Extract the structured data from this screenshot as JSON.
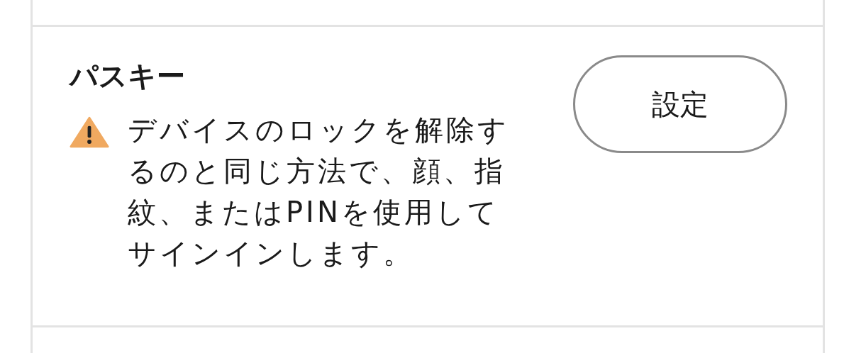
{
  "passkey": {
    "title": "パスキー",
    "description": "デバイスのロックを解除するのと同じ方法で、顔、指紋、またはPINを使用してサインインします。",
    "button": "設定"
  }
}
